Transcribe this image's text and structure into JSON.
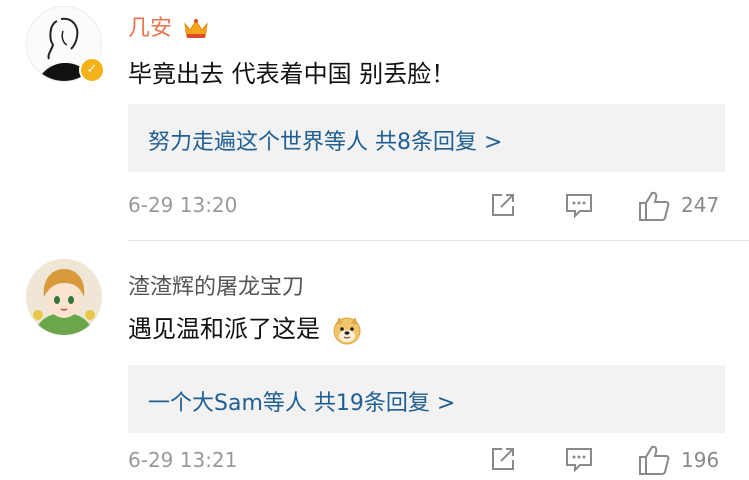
{
  "comments": [
    {
      "username": "几安",
      "text": "毕竟出去 代表着中国 别丢脸！",
      "replies_label": "努力走遍这个世界等人  共8条回复 >",
      "time": "6-29 13:20",
      "likes": "247",
      "icons": [
        "avatar-sketch",
        "verified-badge",
        "vip-crown-icon",
        "share-icon",
        "comment-icon",
        "like-icon"
      ]
    },
    {
      "username": "渣渣辉的屠龙宝刀",
      "text": "遇见温和派了这是",
      "replies_label": "一个大Sam等人  共19条回复 >",
      "time": "6-29 13:21",
      "likes": "196",
      "icons": [
        "avatar-anime-girl",
        "doge-emoji",
        "share-icon",
        "comment-icon",
        "like-icon"
      ]
    }
  ],
  "colors": {
    "username_vip": "#eb7350",
    "link_blue": "#1f5f93",
    "meta_gray": "#999999",
    "reply_bg": "#f2f2f2"
  }
}
